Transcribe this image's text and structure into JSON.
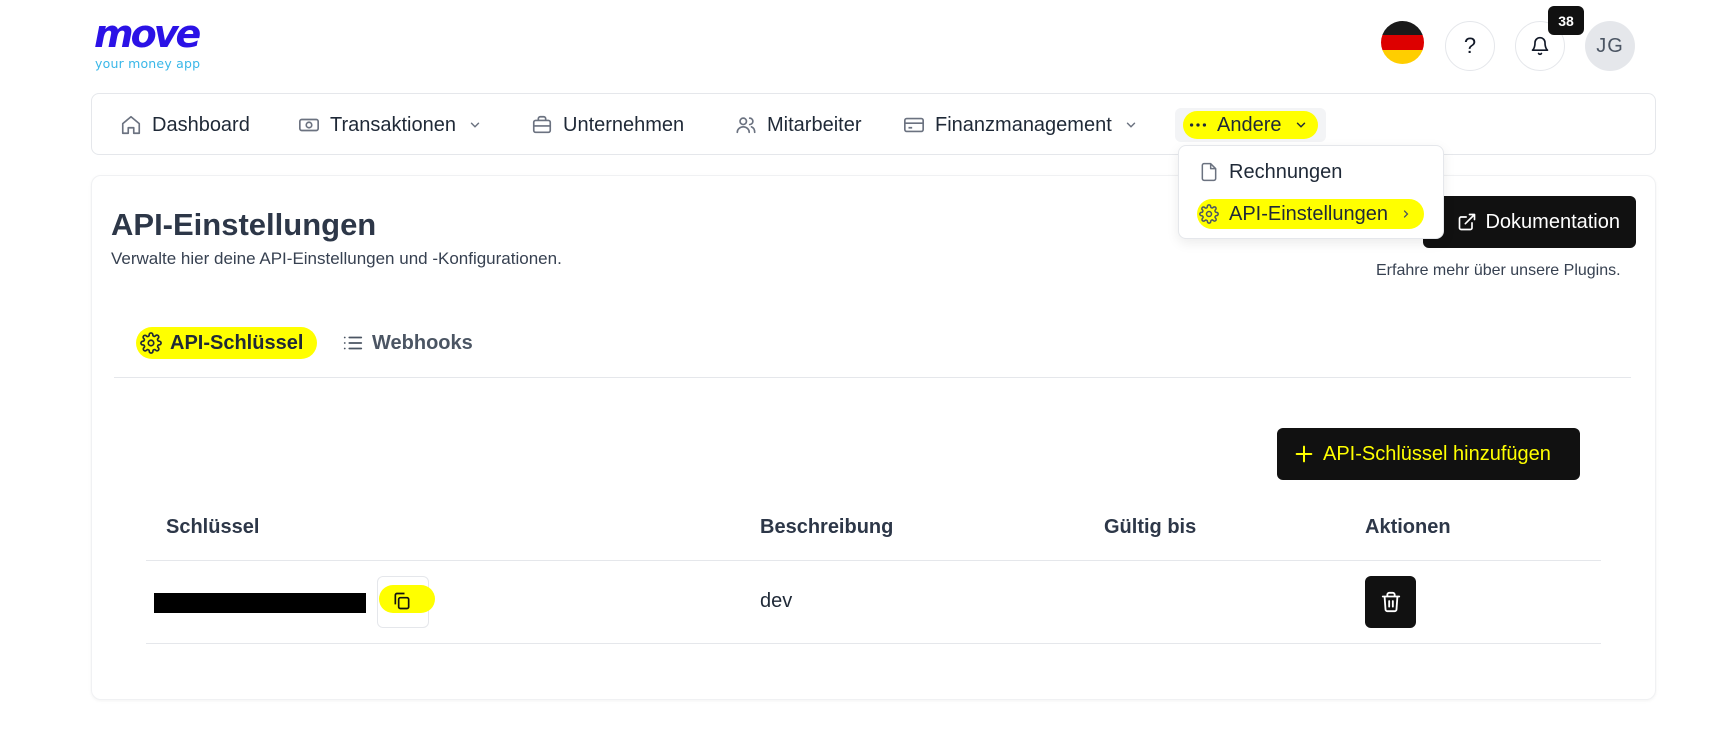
{
  "brand": {
    "name": "move",
    "tagline": "your money app"
  },
  "header": {
    "help_label": "?",
    "notifications_count": "38",
    "avatar_initials": "JG"
  },
  "nav": {
    "dashboard": "Dashboard",
    "transactions": "Transaktionen",
    "company": "Unternehmen",
    "employees": "Mitarbeiter",
    "finance": "Finanzmanagement",
    "other": "Andere"
  },
  "dropdown": {
    "invoices": "Rechnungen",
    "api_settings": "API-Einstellungen"
  },
  "page": {
    "title": "API-Einstellungen",
    "subtitle": "Verwalte hier deine API-Einstellungen und -Konfigurationen.",
    "docs_button": "Dokumentation",
    "plugins_text": "Erfahre mehr über unsere Plugins."
  },
  "tabs": {
    "api_keys": "API-Schlüssel",
    "webhooks": "Webhooks"
  },
  "add_button": "API-Schlüssel hinzufügen",
  "table": {
    "headers": {
      "key": "Schlüssel",
      "description": "Beschreibung",
      "valid_until": "Gültig bis",
      "actions": "Aktionen"
    },
    "rows": [
      {
        "description": "dev",
        "valid_until": ""
      }
    ]
  },
  "colors": {
    "brand": "#2b12e6",
    "tagline": "#39b7e8",
    "highlight": "#ffff00",
    "button_dark": "#111111"
  }
}
